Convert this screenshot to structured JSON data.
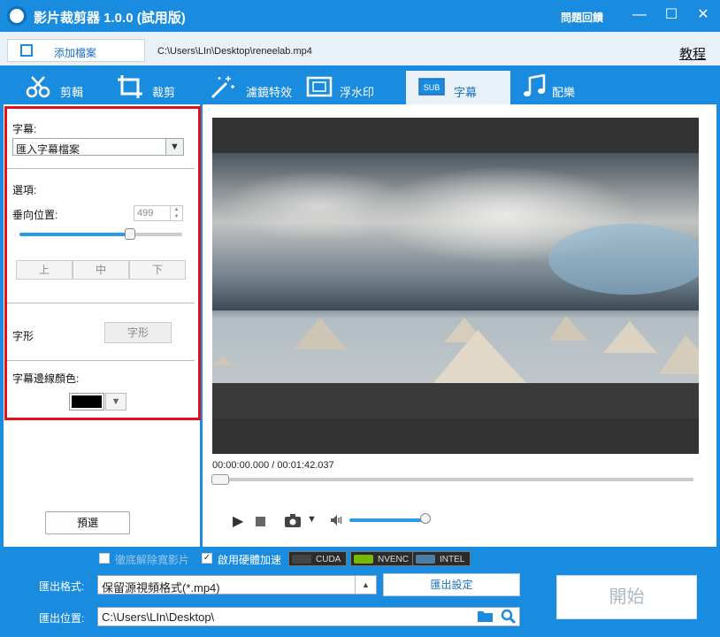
{
  "window": {
    "title": "影片裁剪器 1.0.0 (試用版)",
    "help_label": "問題回饋",
    "minimize": "—",
    "maximize": "☐",
    "close": "✕"
  },
  "toolbar": {
    "add_file_label": "添加檔案",
    "file_path": "C:\\Users\\LIn\\Desktop\\reneelab.mp4",
    "tutorial_label": "教程"
  },
  "tabs": [
    {
      "label": "剪輯",
      "icon": "scissors-icon"
    },
    {
      "label": "裁剪",
      "icon": "crop-icon"
    },
    {
      "label": "濾鏡特效",
      "icon": "magic-wand-icon"
    },
    {
      "label": "浮水印",
      "icon": "watermark-icon"
    },
    {
      "label": "字幕",
      "icon": "subtitle-icon",
      "active": true
    },
    {
      "label": "配樂",
      "icon": "music-note-icon"
    }
  ],
  "subtitle_panel": {
    "subtitle_label": "字幕:",
    "subtitle_select_value": "匯入字幕檔案",
    "options_label": "選項:",
    "vertical_pos_label": "垂向位置:",
    "vertical_pos_value": "499",
    "vertical_pos_level": 0.68,
    "align_top": "上",
    "align_middle": "中",
    "align_bottom": "下",
    "font_label": "字形",
    "font_button": "字形",
    "outline_color_label": "字幕邊線顏色:",
    "outline_color": "#000000"
  },
  "preset_button": "預選",
  "player": {
    "time_display": "00:00:00.000 / 00:01:42.037",
    "progress": 0.0,
    "volume_level": 0.9
  },
  "bottom": {
    "deinterlace_label": "徹底解除寬影片",
    "deinterlace_checked": false,
    "hw_accel_label": "啟用硬體加速",
    "hw_accel_checked": true,
    "badges": [
      "CUDA",
      "NVENC",
      "INTEL"
    ],
    "output_format_label": "匯出格式:",
    "output_format_value": "保留源視頻格式(*.mp4)",
    "output_settings_label": "匯出設定",
    "output_path_label": "匯出位置:",
    "output_path_value": "C:\\Users\\LIn\\Desktop\\",
    "start_label": "開始"
  },
  "colors": {
    "brand_blue": "#1a8ce0",
    "highlight_red": "#e0121a"
  }
}
